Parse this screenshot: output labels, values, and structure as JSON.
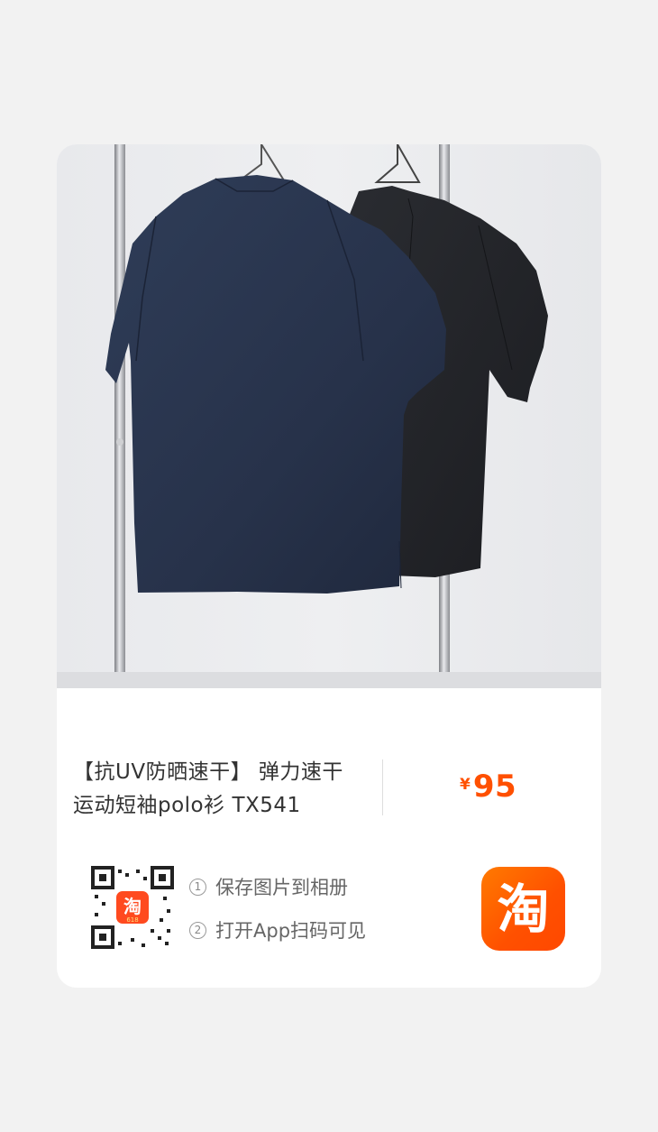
{
  "product": {
    "title": "【抗UV防晒速干】 弹力速干 运动短袖polo衫 TX541",
    "price_symbol": "¥",
    "price": "95",
    "image_icon": "product-photo-two-polo-shirts"
  },
  "share": {
    "step1_num": "1",
    "step1": "保存图片到相册",
    "step2_num": "2",
    "step2": "打开App扫码可见",
    "qr_badge_char": "淘",
    "qr_badge_sub": "618",
    "app_icon_char": "淘",
    "app_icon": "taobao-app-icon",
    "qr_icon": "qr-code-icon"
  },
  "colors": {
    "accent": "#ff5000",
    "page_bg": "#f2f2f2",
    "card_bg": "#ffffff"
  }
}
